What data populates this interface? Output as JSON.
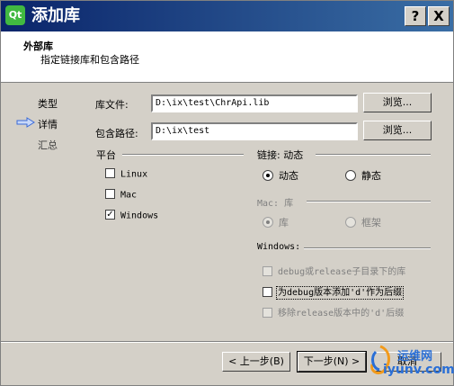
{
  "window": {
    "title": "添加库",
    "logo_text": "Qt",
    "help_label": "?",
    "close_label": "X"
  },
  "header": {
    "title": "外部库",
    "subtitle": "指定链接库和包含路径"
  },
  "steps": [
    {
      "label": "类型",
      "current": false
    },
    {
      "label": "详情",
      "current": true
    },
    {
      "label": "汇总",
      "current": false
    }
  ],
  "library_file": {
    "label": "库文件:",
    "value": "D:\\ix\\test\\ChrApi.lib",
    "browse_label": "浏览..."
  },
  "include_path": {
    "label": "包含路径:",
    "value": "D:\\ix\\test",
    "browse_label": "浏览..."
  },
  "platform": {
    "title": "平台",
    "options": [
      {
        "label": "Linux",
        "checked": false
      },
      {
        "label": "Mac",
        "checked": false
      },
      {
        "label": "Windows",
        "checked": true
      }
    ]
  },
  "linkage": {
    "title": "链接: 动态",
    "options": [
      {
        "label": "动态",
        "selected": true
      },
      {
        "label": "静态",
        "selected": false
      }
    ]
  },
  "mac": {
    "title": "Mac: 库",
    "options": [
      {
        "label": "库",
        "selected": true
      },
      {
        "label": "框架",
        "selected": false
      }
    ]
  },
  "windows": {
    "title": "Windows:",
    "options": [
      {
        "label": "debug或release子目录下的库",
        "checked": false,
        "enabled": false
      },
      {
        "label": "为debug版本添加'd'作为后缀",
        "checked": false,
        "enabled": true
      },
      {
        "label": "移除release版本中的'd'后缀",
        "checked": false,
        "enabled": false
      }
    ]
  },
  "footer": {
    "back_label": "< 上一步(B)",
    "next_label": "下一步(N) >",
    "cancel_label": "取消"
  },
  "watermark": {
    "line1": "运维网",
    "line2": "iyunv.com"
  }
}
